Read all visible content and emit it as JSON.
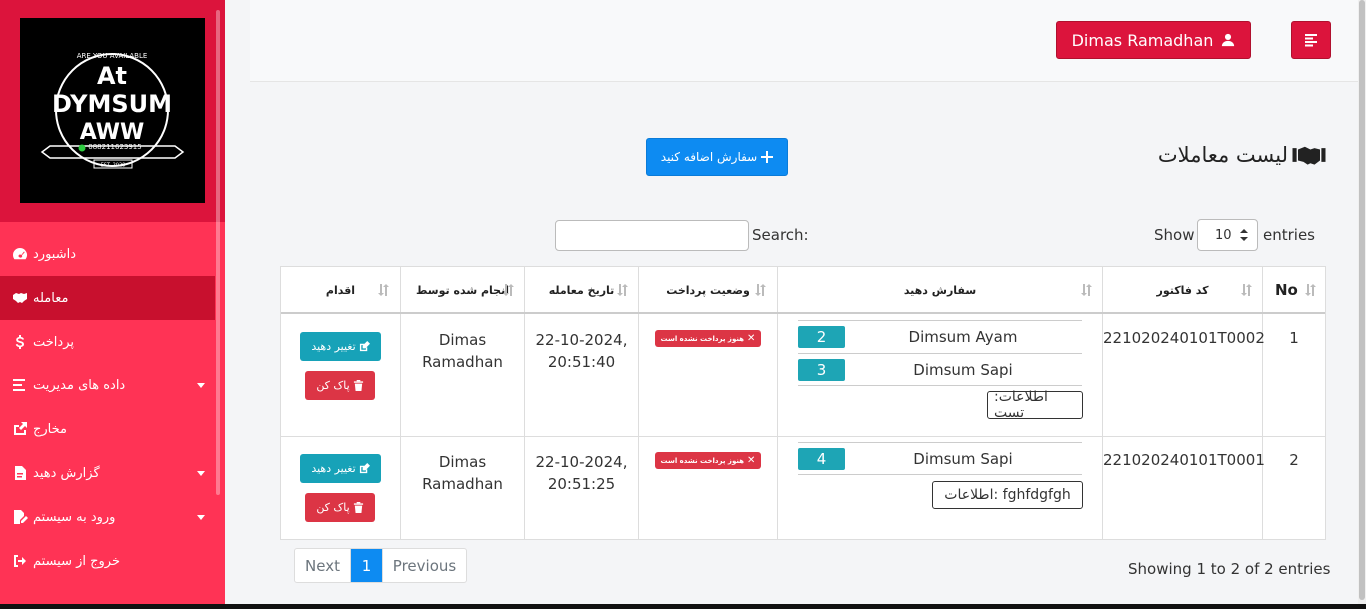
{
  "sidebar": {
    "logo": {
      "line1": "At",
      "line2": "DYMSUM",
      "line3": "AWW",
      "arc_text": "ARE YOU AVAILABLE",
      "phone": "088211623915",
      "est": "EST. 2020"
    },
    "items": [
      {
        "label": "داشبورد",
        "icon": "dashboard-icon"
      },
      {
        "label": "معامله",
        "icon": "handshake-icon"
      },
      {
        "label": "پرداخت",
        "icon": "dollar-icon"
      },
      {
        "label": "داده های مدیریت",
        "icon": "list-icon"
      },
      {
        "label": "مخارج",
        "icon": "share-icon"
      },
      {
        "label": "گزارش دهید",
        "icon": "file-pdf-icon"
      },
      {
        "label": "ورود به سیستم",
        "icon": "file-signature-icon"
      },
      {
        "label": "خروج از سیستم",
        "icon": "sign-out-icon"
      }
    ]
  },
  "header": {
    "user_name": "Dimas Ramadhan"
  },
  "page": {
    "title": "لیست معاملات",
    "add_button": "سفارش اضافه کنید"
  },
  "controls": {
    "show_label": "Show",
    "show_value": "10",
    "entries_label": "entries",
    "search_label": "Search:"
  },
  "table": {
    "headers": {
      "no": "No",
      "invoice": "کد فاکتور",
      "order": "سفارش دهید",
      "payment": "وضعیت پرداخت",
      "date": "تاریخ معامله",
      "by": "انجام شده توسط",
      "action": "اقدام"
    },
    "rows": [
      {
        "no": "1",
        "invoice": "221020240101T0002",
        "items": [
          {
            "name": "Dimsum Ayam",
            "qty": "2"
          },
          {
            "name": "Dimsum Sapi",
            "qty": "3"
          }
        ],
        "info": "اطلاعات: تست",
        "status": "هنوز پرداخت نشده است",
        "date_line1": "22-10-2024,",
        "date_line2": "20:51:40",
        "by_line1": "Dimas",
        "by_line2": "Ramadhan",
        "edit_label": "تغییر دهید",
        "delete_label": "پاک کن"
      },
      {
        "no": "2",
        "invoice": "221020240101T0001",
        "items": [
          {
            "name": "Dimsum Sapi",
            "qty": "4"
          }
        ],
        "info": "اطلاعات: fghfdgfgh",
        "status": "هنوز پرداخت نشده است",
        "date_line1": "22-10-2024,",
        "date_line2": "20:51:25",
        "by_line1": "Dimas",
        "by_line2": "Ramadhan",
        "edit_label": "تغییر دهید",
        "delete_label": "پاک کن"
      }
    ]
  },
  "footer": {
    "showing": "Showing 1 to 2 of 2 entries",
    "next": "Next",
    "current_page": "1",
    "previous": "Previous"
  },
  "colors": {
    "sidebar_primary": "#dc143c",
    "sidebar_menu": "#ff3355",
    "accent_blue": "#0d8bf2",
    "info_teal": "#17a2b8",
    "danger": "#dc3545"
  }
}
